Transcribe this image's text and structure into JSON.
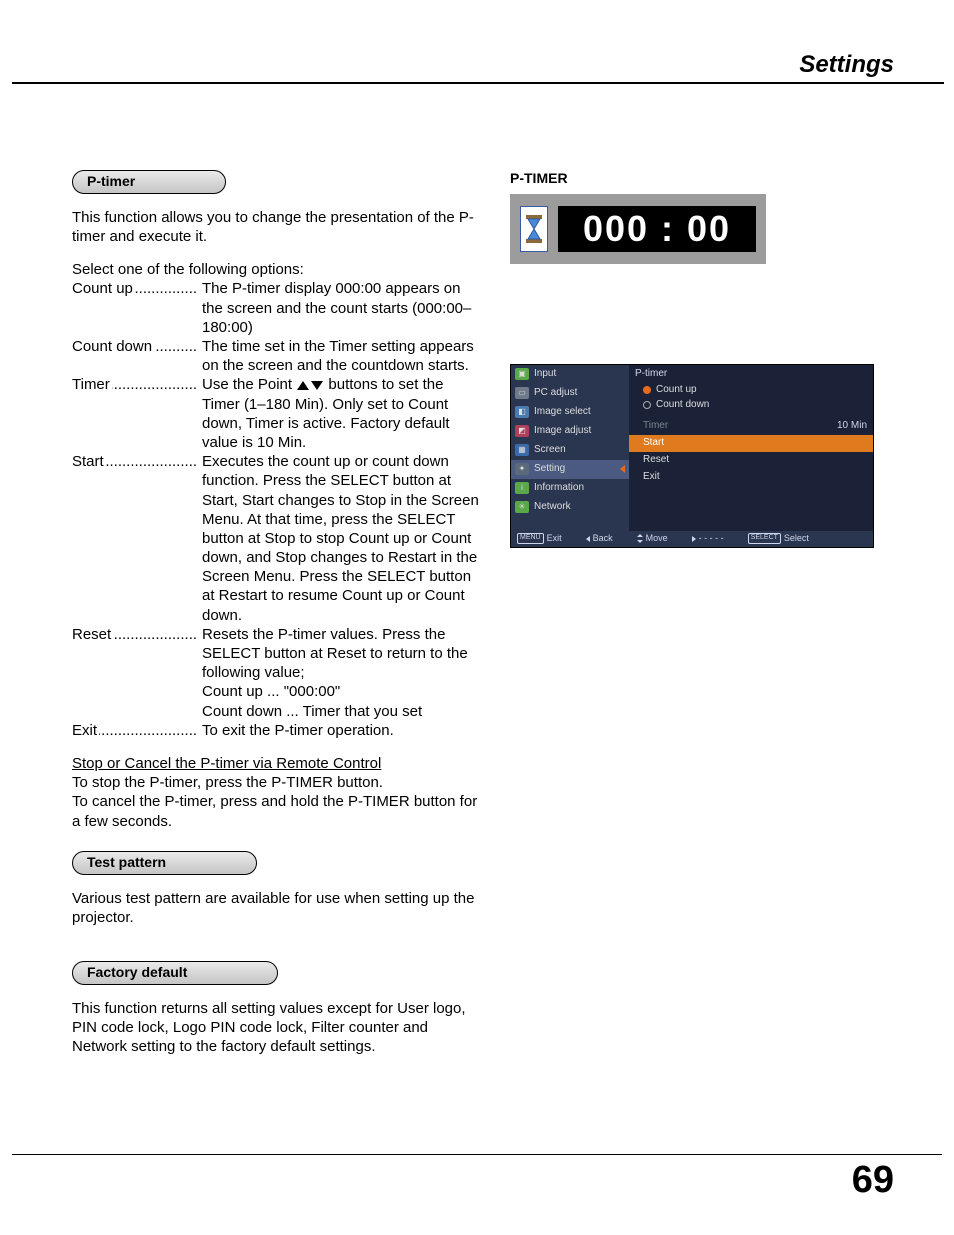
{
  "header": {
    "title": "Settings"
  },
  "page_number": "69",
  "left": {
    "ptimer": {
      "pill": "P-timer",
      "intro": "This function allows you to change the presentation of the P-timer and execute it.",
      "select_line": "Select one of the following options:",
      "defs": [
        {
          "term": "Count up",
          "val": "The P-timer display 000:00 appears on the screen and the count starts (000:00–180:00)"
        },
        {
          "term": "Count down",
          "val": "The time set in the Timer setting appears on the screen and the countdown starts."
        },
        {
          "term": "Timer",
          "val_pre": "Use the Point ",
          "val_post": " buttons to set the Timer (1–180 Min). Only set to Count down, Timer is active. Factory default value is 10 Min."
        },
        {
          "term": "Start",
          "val": "Executes the count up or count down function. Press the SELECT button at Start, Start changes to Stop in the Screen Menu.  At that time, press the SELECT button at Stop to stop Count up or Count down,  and Stop changes to Restart in the Screen Menu. Press the SELECT button at Restart to resume Count up or Count down."
        },
        {
          "term": "Reset",
          "val": "Resets the P-timer values. Press the SELECT button at Reset to return to the following value;\nCount up ... \"000:00\"\nCount down ... Timer that you set"
        },
        {
          "term": "Exit",
          "val": "To exit the P-timer operation."
        }
      ],
      "stop_title": "Stop or Cancel the P-timer via Remote Control",
      "stop_body": "To stop the P-timer, press the P-TIMER button.\nTo cancel the P-timer, press and hold the P-TIMER button for a few seconds."
    },
    "test": {
      "pill": "Test pattern",
      "body": "Various test pattern are available for use when setting up the projector."
    },
    "factory": {
      "pill": "Factory default",
      "body": "This function returns all setting values except for User logo, PIN code lock, Logo PIN code lock, Filter counter and Network setting to the factory default settings."
    }
  },
  "right": {
    "caption": "P-TIMER",
    "timer_readout": "000 : 00",
    "osd": {
      "left": [
        {
          "label": "Input",
          "color": "#5aa84a"
        },
        {
          "label": "PC adjust",
          "color": "#707a8a"
        },
        {
          "label": "Image select",
          "color": "#4a7aae"
        },
        {
          "label": "Image adjust",
          "color": "#b0405a"
        },
        {
          "label": "Screen",
          "color": "#3a6aa8"
        },
        {
          "label": "Setting",
          "color": "#5a6a7a",
          "selected": true
        },
        {
          "label": "Information",
          "color": "#5aa84a"
        },
        {
          "label": "Network",
          "color": "#5aa84a"
        }
      ],
      "title": "P-timer",
      "radios": [
        {
          "label": "Count up",
          "on": true
        },
        {
          "label": "Count down",
          "on": false
        }
      ],
      "rows": [
        {
          "label": "Timer",
          "value": "10  Min",
          "dim": true
        },
        {
          "label": "Start",
          "hl": true
        },
        {
          "label": "Reset"
        },
        {
          "label": "Exit"
        }
      ],
      "footer": {
        "exit": "Exit",
        "back": "Back",
        "move": "Move",
        "dash": "- - - - -",
        "select": "Select",
        "menu_badge": "MENU",
        "select_badge": "SELECT"
      }
    }
  }
}
